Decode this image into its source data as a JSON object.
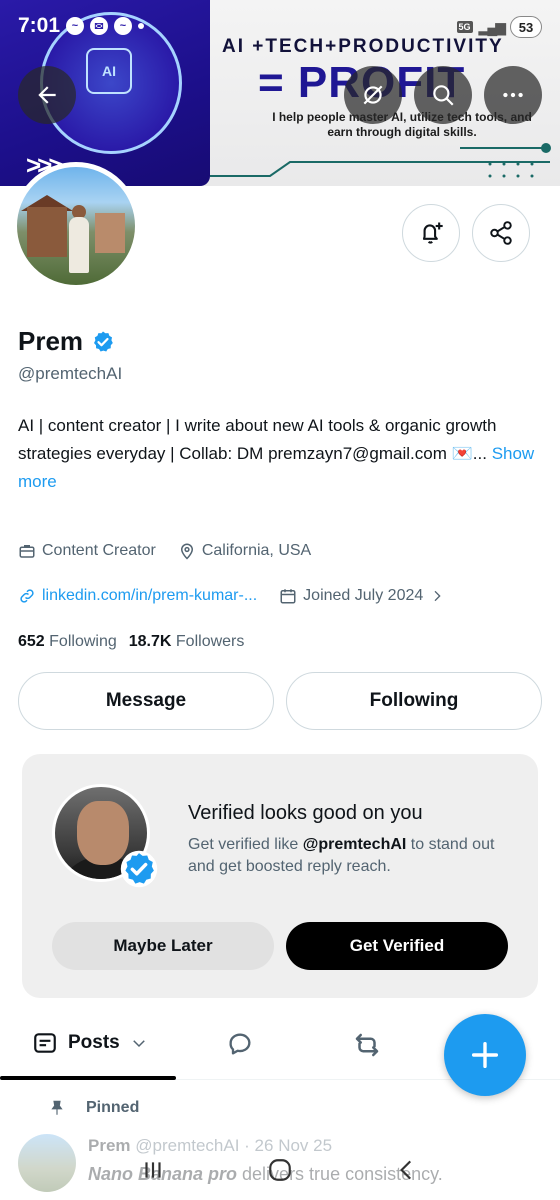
{
  "status_bar": {
    "time": "7:01",
    "network": "5G",
    "battery": "53"
  },
  "banner": {
    "chip_label": "AI",
    "headline": "AI +TECH+PRODUCTIVITY",
    "big_text": "= PROFIT",
    "subtext": "I help people master AI, utilize tech tools, and earn through digital skills."
  },
  "profile": {
    "name": "Prem",
    "handle": "@premtechAI",
    "bio_text": "AI | content creator | I write about new AI tools & organic growth strategies everyday | Collab: DM premzayn7@gmail.com 💌...",
    "show_more": "Show more",
    "category": "Content Creator",
    "location": "California, USA",
    "link": "linkedin.com/in/prem-kumar-...",
    "joined": "Joined July 2024",
    "following_count": "652",
    "following_label": "Following",
    "followers_count": "18.7K",
    "followers_label": "Followers"
  },
  "buttons": {
    "message": "Message",
    "following": "Following"
  },
  "verify_card": {
    "title": "Verified looks good on you",
    "text_before": "Get verified like ",
    "text_handle": "@premtechAI",
    "text_after": " to stand out and get boosted reply reach.",
    "maybe_later": "Maybe Later",
    "get_verified": "Get Verified"
  },
  "tabs": {
    "posts": "Posts"
  },
  "pinned": {
    "label": "Pinned"
  },
  "tweet_peek": {
    "name": "Prem",
    "handle_date": "@premtechAI · 26 Nov 25",
    "text_bold": "Nano Banana pro",
    "text_rest": " delivers true consistency."
  },
  "colors": {
    "accent": "#1d9bf0",
    "banner_blue": "#1f1794",
    "text_secondary": "#536471"
  }
}
